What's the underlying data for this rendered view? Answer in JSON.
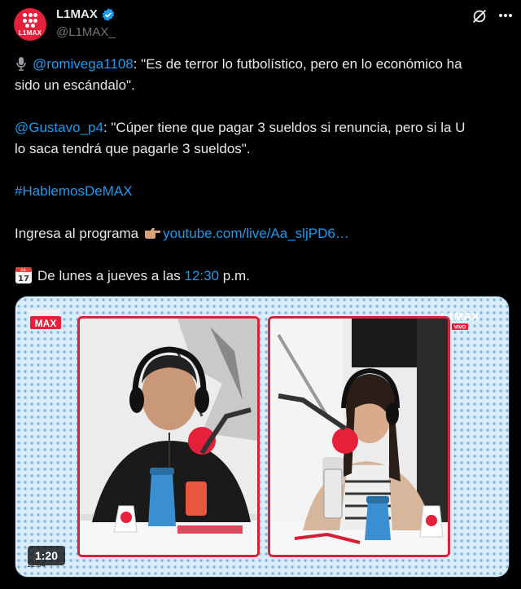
{
  "account": {
    "name": "L1MAX",
    "handle": "@L1MAX_",
    "avatar_text": "L1MAX",
    "verified": true
  },
  "tweet": {
    "line1_mention": "@romivega1108",
    "line1_text": ": \"Es de terror lo futbolístico, pero en lo económico ha",
    "line2_text": "sido un escándalo\".",
    "line3_mention": "@Gustavo_p4",
    "line3_text": ": \"Cúper tiene que pagar 3 sueldos si renuncia, pero si la U",
    "line4_text": "lo saca tendrá que pagarle 3 sueldos\".",
    "hashtag": "#HablemosDeMAX",
    "cta_text": "Ingresa al programa",
    "link": "youtube.com/live/Aa_sljPD6…",
    "schedule_prefix": "De lunes a jueves a las",
    "schedule_time": "12:30",
    "schedule_suffix": "p.m."
  },
  "icons": {
    "mic": "microphone-icon",
    "hand": "pointing-hand-icon",
    "calendar": "calendar-icon",
    "calendar_day": "17",
    "calendar_month": "JUL",
    "grok": "grok-icon",
    "more": "more-options-icon",
    "verified": "verified-badge-icon"
  },
  "media": {
    "duration": "1:20",
    "clock": "12:54",
    "logo_left": "MAX",
    "logo_right": "L1MAX",
    "logo_right_sub": "VIVO"
  },
  "colors": {
    "accent": "#1d9bf0",
    "brand_red": "#e5203a",
    "background": "#000000"
  }
}
